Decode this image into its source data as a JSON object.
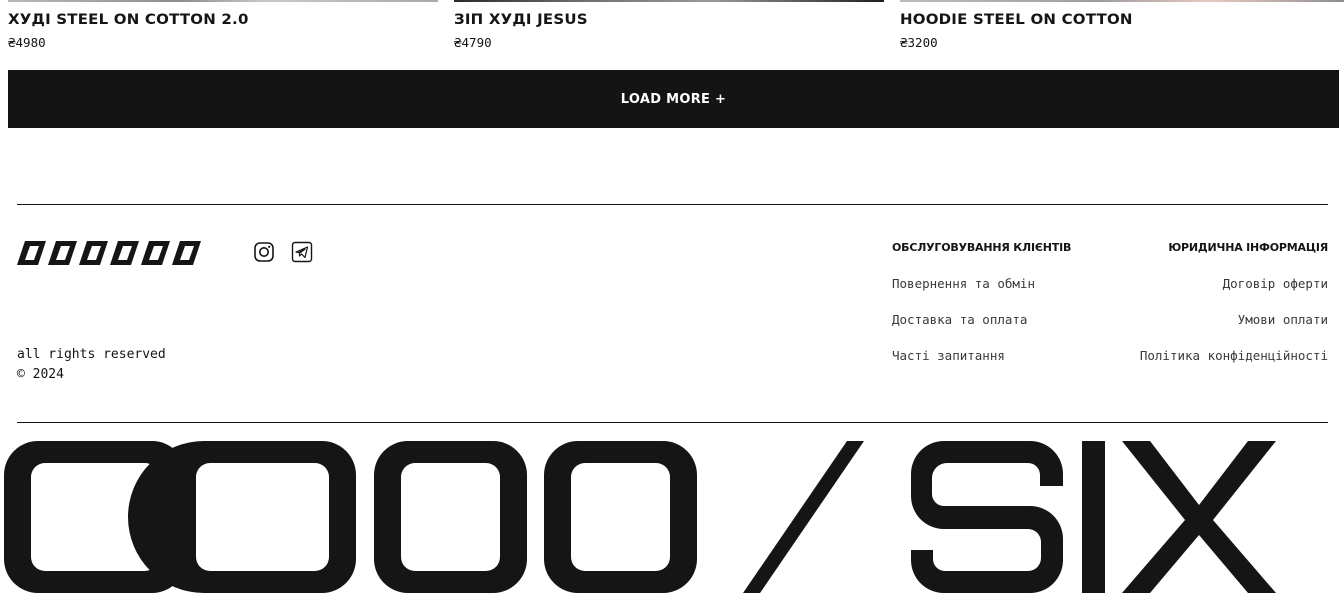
{
  "products": [
    {
      "name": "ХУДІ STEEL ON COTTON 2.0",
      "price": "₴4980"
    },
    {
      "name": "ЗІП ХУДІ JESUS",
      "price": "₴4790"
    },
    {
      "name": "HOODIE STEEL ON COTTON",
      "price": "₴3200"
    }
  ],
  "load_more": {
    "label": "LOAD MORE +"
  },
  "footer": {
    "social": {
      "instagram": "instagram-icon",
      "telegram": "telegram-icon"
    },
    "rights_line": "all rights reserved",
    "copyright_year": "2024",
    "customer_service": {
      "title": "Обслуговування клієнтів",
      "links": [
        "Повернення та обмін",
        "Доставка та оплата",
        "Часті запитання"
      ]
    },
    "legal": {
      "title": "Юридична інформація",
      "links": [
        "Договір оферти",
        "Умови оплати",
        "Політика конфіденційності"
      ]
    },
    "big_brand": {
      "prefix": "0000",
      "slash": "/",
      "word": "SIX"
    }
  }
}
